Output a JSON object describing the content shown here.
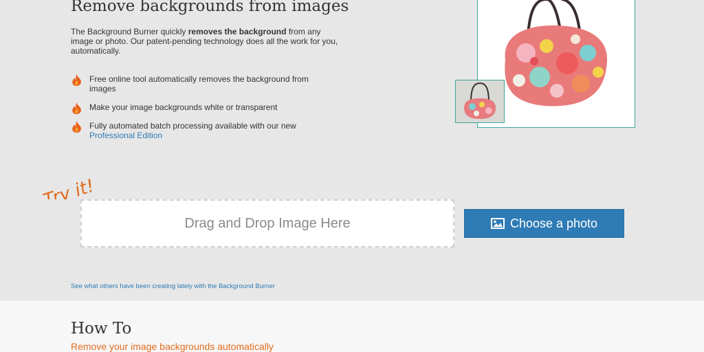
{
  "hero": {
    "title": "Remove backgrounds from images",
    "intro_before": "The Background Burner quickly ",
    "intro_bold": "removes the background",
    "intro_after": " from any image or photo. Our patent-pending technology does all the work for you, automatically.",
    "features": [
      {
        "text": "Free online tool automatically removes the background from images",
        "link": ""
      },
      {
        "text": "Make your image backgrounds white or transparent",
        "link": ""
      },
      {
        "text": "Fully automated batch processing available with our new ",
        "link": "Professional Edition"
      }
    ]
  },
  "upload": {
    "try_it": "Try it!",
    "dropzone_text": "Drag and Drop Image Here",
    "choose_label": "Choose a photo",
    "others_link": "See what others have been creating lately with the Background Burner"
  },
  "howto": {
    "title": "How To",
    "subtitle": "Remove your image backgrounds automatically"
  },
  "colors": {
    "accent_blue": "#2e7bb5",
    "accent_orange": "#e06c1f",
    "frame_teal": "#3aa99a",
    "hero_bg": "#e7e7e7"
  },
  "icons": {
    "feature_bullet": "flame-icon",
    "choose_button": "image-icon"
  }
}
